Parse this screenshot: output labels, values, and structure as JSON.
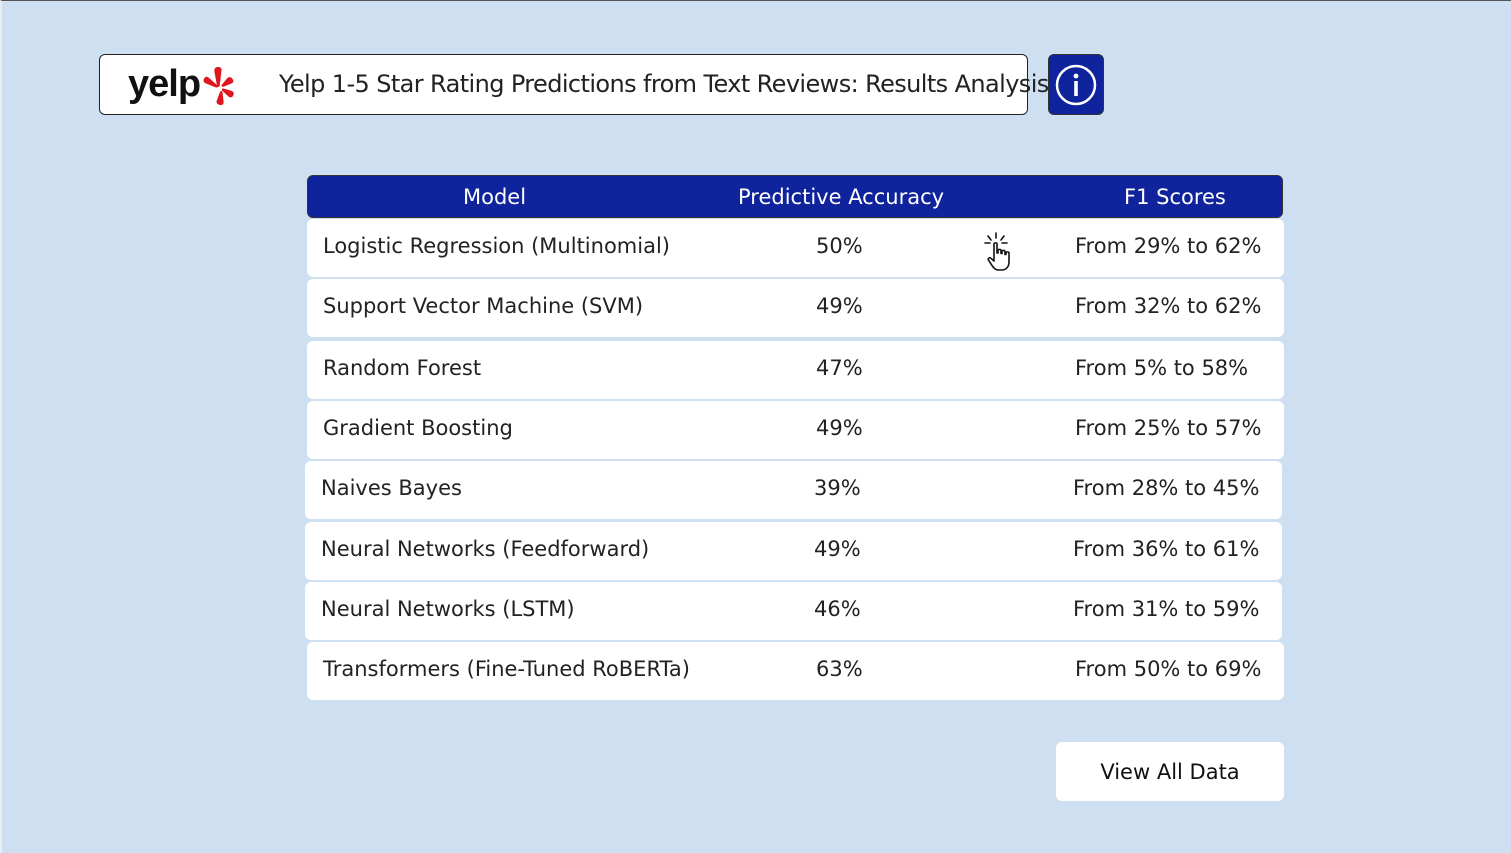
{
  "header": {
    "logo_text": "yelp",
    "title": "Yelp 1-5 Star Rating Predictions from Text Reviews: Results Analysis"
  },
  "info_button": {
    "icon": "info-icon"
  },
  "table": {
    "columns": [
      "Model",
      "Predictive Accuracy",
      "F1 Scores"
    ],
    "rows": [
      {
        "model": "Logistic Regression (Multinomial)",
        "accuracy": "50%",
        "f1": "From 29% to 62%"
      },
      {
        "model": "Support Vector Machine (SVM)",
        "accuracy": "49%",
        "f1": "From 32% to 62%"
      },
      {
        "model": "Random Forest",
        "accuracy": "47%",
        "f1": "From 5% to 58%"
      },
      {
        "model": "Gradient Boosting",
        "accuracy": "49%",
        "f1": "From 25% to 57%"
      },
      {
        "model": "Naives Bayes",
        "accuracy": "39%",
        "f1": "From 28% to 45%"
      },
      {
        "model": "Neural Networks (Feedforward)",
        "accuracy": "49%",
        "f1": "From 36% to 61%"
      },
      {
        "model": "Neural Networks (LSTM)",
        "accuracy": "46%",
        "f1": "From 31% to 59%"
      },
      {
        "model": "Transformers (Fine-Tuned RoBERTa)",
        "accuracy": "63%",
        "f1": "From 50% to 69%"
      }
    ]
  },
  "view_all_button": {
    "label": "View All Data"
  },
  "colors": {
    "background": "#cddff0",
    "header_blue": "#0f239d",
    "yelp_red": "#e0161e"
  }
}
